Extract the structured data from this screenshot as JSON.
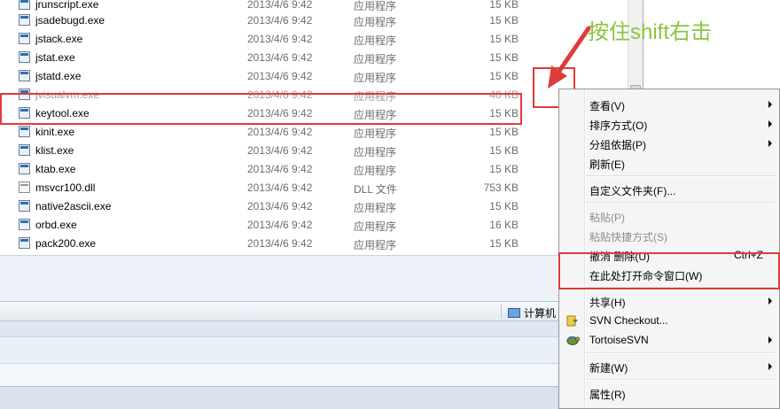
{
  "files": [
    {
      "name": "jrunscript.exe",
      "date": "2013/4/6 9:42",
      "type": "应用程序",
      "size": "15 KB",
      "icon": "exe-icon"
    },
    {
      "name": "jsadebugd.exe",
      "date": "2013/4/6 9:42",
      "type": "应用程序",
      "size": "15 KB",
      "icon": "exe-icon"
    },
    {
      "name": "jstack.exe",
      "date": "2013/4/6 9:42",
      "type": "应用程序",
      "size": "15 KB",
      "icon": "exe-icon"
    },
    {
      "name": "jstat.exe",
      "date": "2013/4/6 9:42",
      "type": "应用程序",
      "size": "15 KB",
      "icon": "exe-icon"
    },
    {
      "name": "jstatd.exe",
      "date": "2013/4/6 9:42",
      "type": "应用程序",
      "size": "15 KB",
      "icon": "exe-icon"
    },
    {
      "name": "jvisualvm.exe",
      "date": "2013/4/6 9:42",
      "type": "应用程序",
      "size": "40 KB",
      "icon": "exe-icon"
    },
    {
      "name": "keytool.exe",
      "date": "2013/4/6 9:42",
      "type": "应用程序",
      "size": "15 KB",
      "icon": "exe-icon"
    },
    {
      "name": "kinit.exe",
      "date": "2013/4/6 9:42",
      "type": "应用程序",
      "size": "15 KB",
      "icon": "exe-icon"
    },
    {
      "name": "klist.exe",
      "date": "2013/4/6 9:42",
      "type": "应用程序",
      "size": "15 KB",
      "icon": "exe-icon"
    },
    {
      "name": "ktab.exe",
      "date": "2013/4/6 9:42",
      "type": "应用程序",
      "size": "15 KB",
      "icon": "exe-icon"
    },
    {
      "name": "msvcr100.dll",
      "date": "2013/4/6 9:42",
      "type": "DLL 文件",
      "size": "753 KB",
      "icon": "dll-icon"
    },
    {
      "name": "native2ascii.exe",
      "date": "2013/4/6 9:42",
      "type": "应用程序",
      "size": "15 KB",
      "icon": "exe-icon"
    },
    {
      "name": "orbd.exe",
      "date": "2013/4/6 9:42",
      "type": "应用程序",
      "size": "16 KB",
      "icon": "exe-icon"
    },
    {
      "name": "pack200.exe",
      "date": "2013/4/6 9:42",
      "type": "应用程序",
      "size": "15 KB",
      "icon": "exe-icon"
    }
  ],
  "annotation": {
    "text": "按住shift右击",
    "color": "#8bc53f",
    "highlight_color": "#e03a3a"
  },
  "status_bar": {
    "computer_label": "计算机"
  },
  "context_menu": {
    "items": [
      {
        "label": "查看(V)",
        "submenu": true,
        "disabled": false
      },
      {
        "label": "排序方式(O)",
        "submenu": true,
        "disabled": false
      },
      {
        "label": "分组依据(P)",
        "submenu": true,
        "disabled": false
      },
      {
        "label": "刷新(E)",
        "submenu": false,
        "disabled": false
      },
      {
        "label": "自定义文件夹(F)...",
        "submenu": false,
        "disabled": false
      },
      {
        "label": "粘贴(P)",
        "submenu": false,
        "disabled": true
      },
      {
        "label": "粘贴快捷方式(S)",
        "submenu": false,
        "disabled": true
      },
      {
        "label": "撤消 删除(U)",
        "shortcut": "Ctrl+Z",
        "submenu": false,
        "disabled": false
      },
      {
        "label": "在此处打开命令窗口(W)",
        "submenu": false,
        "disabled": false
      },
      {
        "label": "共享(H)",
        "submenu": true,
        "disabled": false
      },
      {
        "label": "SVN Checkout...",
        "submenu": false,
        "disabled": false,
        "icon": "svn-checkout-icon"
      },
      {
        "label": "TortoiseSVN",
        "submenu": true,
        "disabled": false,
        "icon": "tortoisesvn-icon"
      },
      {
        "label": "新建(W)",
        "submenu": true,
        "disabled": false
      },
      {
        "label": "属性(R)",
        "submenu": false,
        "disabled": false
      }
    ]
  }
}
